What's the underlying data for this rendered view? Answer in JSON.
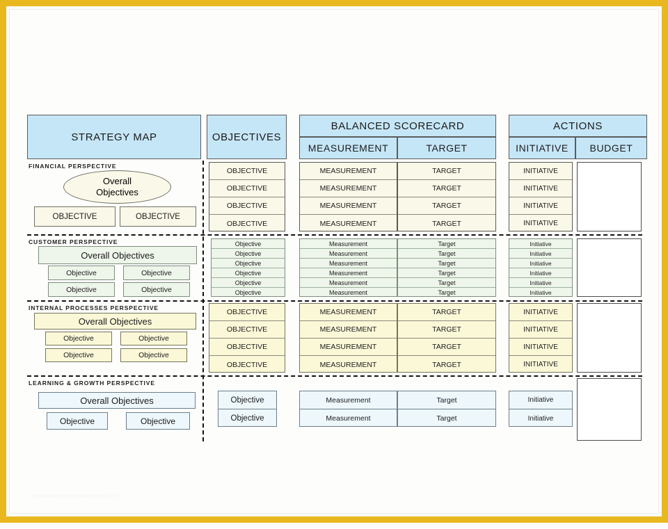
{
  "page": {
    "frame_color": "#e8b81e",
    "header_fill": "#c5e6f7",
    "footer_note": "www.example-templates.com 2015"
  },
  "headers": {
    "strategy_map": "STRATEGY MAP",
    "objectives": "OBJECTIVES",
    "balanced_scorecard": "BALANCED SCORECARD",
    "measurement": "MEASUREMENT",
    "target": "TARGET",
    "actions": "ACTIONS",
    "initiative": "INITIATIVE",
    "budget": "BUDGET"
  },
  "perspectives": [
    {
      "id": "financial",
      "label": "FINANCIAL PERSPECTIVE",
      "fill": "#faf8e8",
      "stroke": "#6f6f63",
      "overall_label": "Overall\nObjectives",
      "overall_line1": "Overall",
      "overall_line2": "Objectives",
      "overall_shape": "ellipse",
      "sub_objectives": [
        "OBJECTIVE",
        "OBJECTIVE"
      ],
      "rows": [
        {
          "objective": "OBJECTIVE",
          "measurement": "MEASUREMENT",
          "target": "TARGET",
          "initiative": "INITIATIVE"
        },
        {
          "objective": "OBJECTIVE",
          "measurement": "MEASUREMENT",
          "target": "TARGET",
          "initiative": "INITIATIVE"
        },
        {
          "objective": "OBJECTIVE",
          "measurement": "MEASUREMENT",
          "target": "TARGET",
          "initiative": "INITIATIVE"
        },
        {
          "objective": "OBJECTIVE",
          "measurement": "MEASUREMENT",
          "target": "TARGET",
          "initiative": "INITIATIVE"
        }
      ],
      "budget": ""
    },
    {
      "id": "customer",
      "label": "CUSTOMER  PERSPECTIVE",
      "fill": "#eef5ea",
      "stroke": "#7d8d7d",
      "overall_label": "Overall Objectives",
      "overall_shape": "rect",
      "sub_objectives": [
        "Objective",
        "Objective",
        "Objective",
        "Objective"
      ],
      "rows": [
        {
          "objective": "Objective",
          "measurement": "Measurement",
          "target": "Target",
          "initiative": "Initiative"
        },
        {
          "objective": "Objective",
          "measurement": "Measurement",
          "target": "Target",
          "initiative": "Initiative"
        },
        {
          "objective": "Objective",
          "measurement": "Measurement",
          "target": "Target",
          "initiative": "Initiative"
        },
        {
          "objective": "Objective",
          "measurement": "Measurement",
          "target": "Target",
          "initiative": "Initiative"
        },
        {
          "objective": "Objective",
          "measurement": "Measurement",
          "target": "Target",
          "initiative": "Initiative"
        },
        {
          "objective": "Objective",
          "measurement": "Measurement",
          "target": "Target",
          "initiative": "Initiative"
        }
      ],
      "budget": ""
    },
    {
      "id": "internal",
      "label": "INTERNAL  PROCESSES  PERSPECTIVE",
      "fill": "#fbf8d8",
      "stroke": "#77745a",
      "overall_label": "Overall Objectives",
      "overall_shape": "rect",
      "sub_objectives": [
        "Objective",
        "Objective",
        "Objective",
        "Objective"
      ],
      "rows": [
        {
          "objective": "OBJECTIVE",
          "measurement": "MEASUREMENT",
          "target": "TARGET",
          "initiative": "INITIATIVE"
        },
        {
          "objective": "OBJECTIVE",
          "measurement": "MEASUREMENT",
          "target": "TARGET",
          "initiative": "INITIATIVE"
        },
        {
          "objective": "OBJECTIVE",
          "measurement": "MEASUREMENT",
          "target": "TARGET",
          "initiative": "INITIATIVE"
        },
        {
          "objective": "OBJECTIVE",
          "measurement": "MEASUREMENT",
          "target": "TARGET",
          "initiative": "INITIATIVE"
        }
      ],
      "budget": ""
    },
    {
      "id": "learning",
      "label": "LEARNING & GROWTH  PERSPECTIVE",
      "fill": "#eef7fb",
      "stroke": "#6b7f8c",
      "overall_label": "Overall Objectives",
      "overall_shape": "rect",
      "sub_objectives": [
        "Objective",
        "Objective"
      ],
      "rows": [
        {
          "objective": "Objective",
          "measurement": "Measurement",
          "target": "Target",
          "initiative": "Initiative"
        },
        {
          "objective": "Objective",
          "measurement": "Measurement",
          "target": "Target",
          "initiative": "Initiative"
        }
      ],
      "budget": ""
    }
  ]
}
